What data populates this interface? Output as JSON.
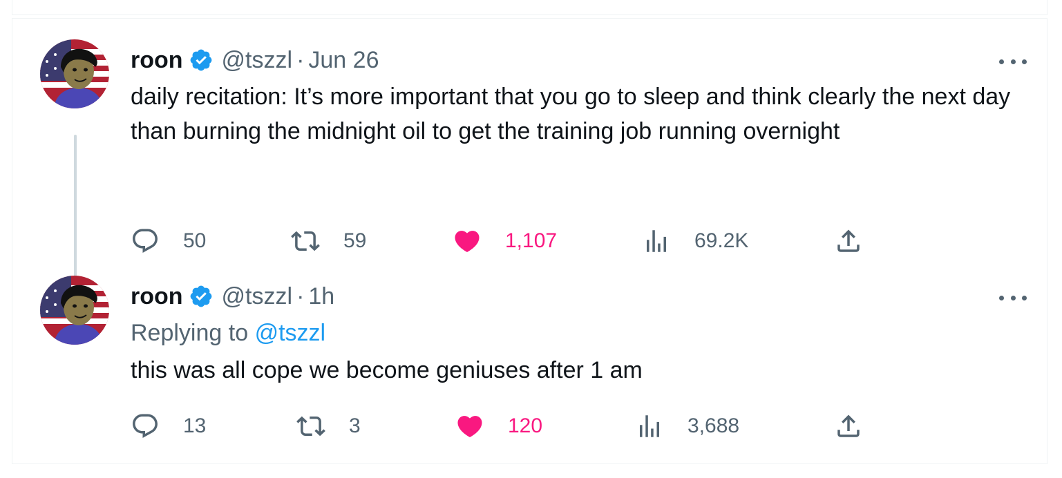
{
  "colors": {
    "text": "#0f1419",
    "secondary": "#536471",
    "accent": "#1d9bf0",
    "like": "#f91880",
    "verified": "#1d9bf0"
  },
  "tweets": [
    {
      "name": "roon",
      "handle": "@tszzl",
      "separator": "·",
      "time": "Jun 26",
      "text": "daily recitation: It’s more important that you go to sleep and think clearly the next day than burning the midnight oil to get the training job running overnight",
      "actions": {
        "replies": "50",
        "retweets": "59",
        "likes": "1,107",
        "views": "69.2K"
      },
      "icons": [
        "reply-icon",
        "retweet-icon",
        "heart-icon",
        "views-icon",
        "share-icon"
      ]
    },
    {
      "name": "roon",
      "handle": "@tszzl",
      "separator": "·",
      "time": "1h",
      "replying_to_label": "Replying to",
      "replying_to_handle": "@tszzl",
      "text": "this was all cope we become geniuses after 1 am",
      "actions": {
        "replies": "13",
        "retweets": "3",
        "likes": "120",
        "views": "3,688"
      },
      "icons": [
        "reply-icon",
        "retweet-icon",
        "heart-icon",
        "views-icon",
        "share-icon"
      ]
    }
  ]
}
